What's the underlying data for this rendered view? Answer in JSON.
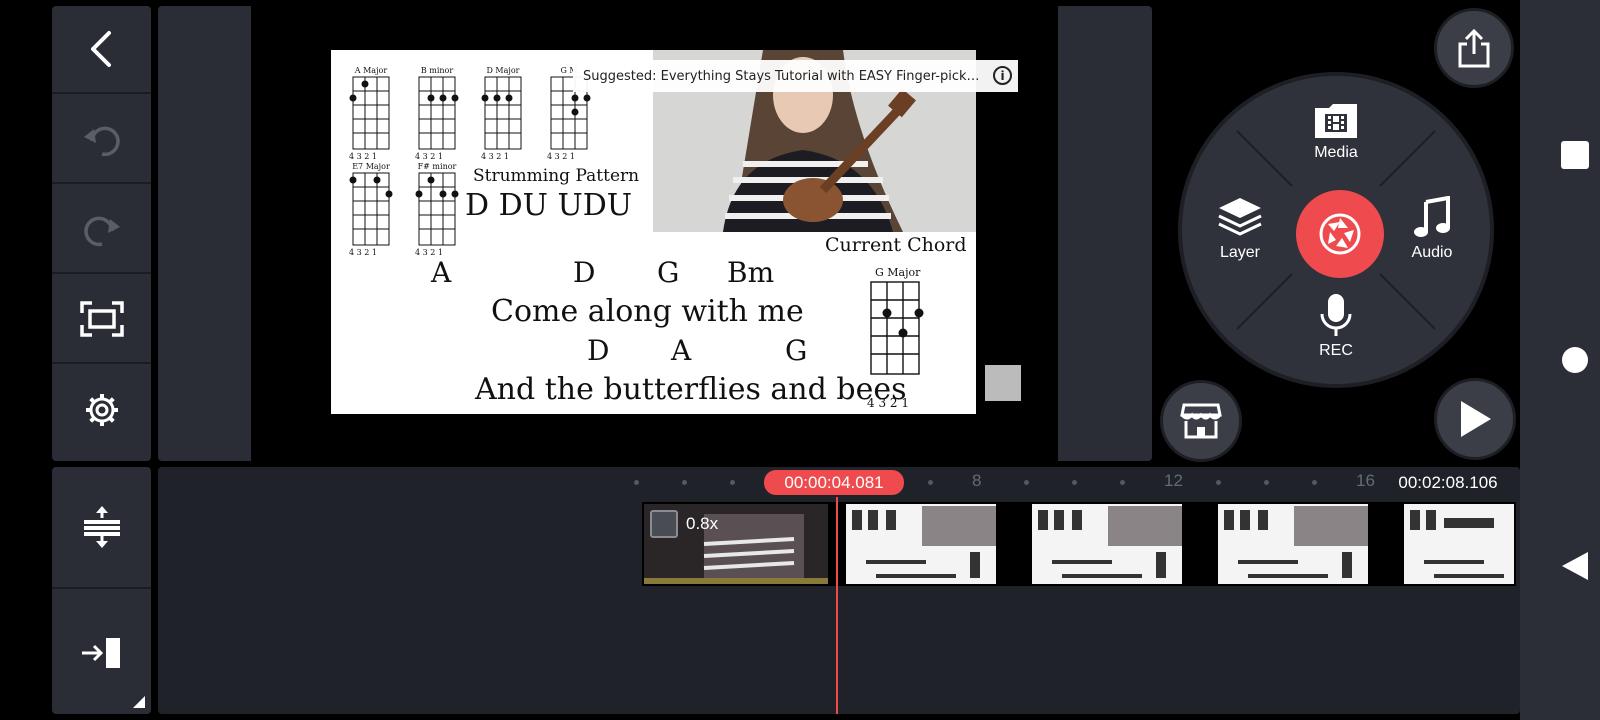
{
  "preview": {
    "suggestion": "Suggested: Everything Stays Tutorial with EASY Finger-picking Patt...",
    "info": "i",
    "chords_top": [
      "A Major",
      "B minor",
      "D Major",
      "G M"
    ],
    "chords_bottom": [
      "E7 Major",
      "F# minor"
    ],
    "fret_numbers": "4 3 2 1",
    "strumming_title": "Strumming Pattern",
    "strumming_pattern": "D DU UDU",
    "current_chord_label": "Current Chord",
    "current_chord_name": "G Major",
    "lyric_chords_1": [
      "A",
      "D",
      "G",
      "Bm"
    ],
    "lyric_line_1": "Come along with me",
    "lyric_chords_2": [
      "D",
      "A",
      "G"
    ],
    "lyric_line_2": "And the butterflies and bees"
  },
  "wheel": {
    "media": "Media",
    "layer": "Layer",
    "audio": "Audio",
    "rec": "REC"
  },
  "timeline": {
    "current_time": "00:00:04.081",
    "total_time": "00:02:08.106",
    "ruler_labels": [
      "8",
      "12",
      "16"
    ],
    "clip_speed": "0.8x"
  },
  "colors": {
    "accent": "#ef4b4f",
    "panel": "#2a2d36",
    "timeline_bg": "#202229"
  }
}
